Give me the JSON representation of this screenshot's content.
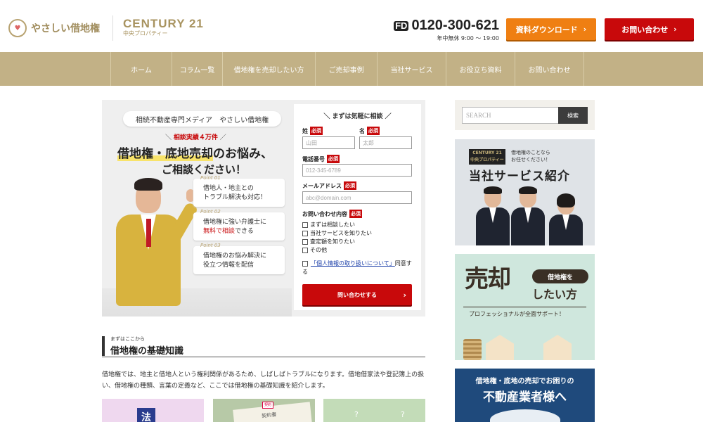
{
  "header": {
    "site_name": "やさしい借地権",
    "brand": "CENTURY 21",
    "brand_sub": "中央プロパティー",
    "phone_prefix": "FD",
    "phone": "0120-300-621",
    "hours": "年中無休 9:00 〜 19:00",
    "download_label": "資料ダウンロード",
    "contact_label": "お問い合わせ"
  },
  "nav": {
    "items": [
      {
        "label": "ホーム"
      },
      {
        "label": "コラム一覧"
      },
      {
        "label": "借地権を売却したい方"
      },
      {
        "label": "ご売却事例"
      },
      {
        "label": "当社サービス"
      },
      {
        "label": "お役立ち資料"
      },
      {
        "label": "お問い合わせ"
      }
    ]
  },
  "hero": {
    "media_tag": "相続不動産専門メディア　やさしい借地権",
    "record_prefix": "＼ ",
    "record": "相談実績４万件",
    "record_suffix": " ／",
    "headline_a": "借地権・底地売却",
    "headline_b": "のお悩み、",
    "headline_2": "ご相談ください！",
    "points": [
      {
        "label": "Point 01",
        "line1": "借地人・地主との",
        "line2": "トラブル解決も対応！"
      },
      {
        "label": "Point 02",
        "line1": "借地権に強い弁護士に",
        "line2a": "無料で相談",
        "line2b": "できる"
      },
      {
        "label": "Point 03",
        "line1": "借地権のお悩み解決に",
        "line2": "役立つ情報を配信"
      }
    ]
  },
  "form": {
    "title": "＼ まずは気軽に相談 ／",
    "required": "必須",
    "last_name_label": "姓",
    "last_name_placeholder": "山田",
    "first_name_label": "名",
    "first_name_placeholder": "太郎",
    "phone_label": "電話番号",
    "phone_placeholder": "012-345-6789",
    "email_label": "メールアドレス",
    "email_placeholder": "abc@domain.com",
    "inquiry_label": "お問い合わせ内容",
    "options": [
      "まずは相談したい",
      "当社サービスを知りたい",
      "査定額を知りたい",
      "その他"
    ],
    "privacy_link": "「個人情報の取り扱いについて」",
    "privacy_suffix": "同意する",
    "submit_label": "問い合わせする"
  },
  "section": {
    "subtitle": "まずはここから",
    "title": "借地権の基礎知識",
    "body": "借地権では、地主と借地人という権利関係があるため、しばしばトラブルになります。借地借家法や登記簿上の扱い、借地権の種類、言葉の定義など、ここでは借地権の基礎知識を紹介します。",
    "thumb1_text": "法",
    "thumb2_text": "契約書",
    "thumb2_stamp": "契約",
    "thumb3_q": "?"
  },
  "sidebar": {
    "search_placeholder": "SEARCH",
    "search_button": "検索",
    "banner1": {
      "logo": "CENTURY 21",
      "logo_sub": "中央プロパティー",
      "tag1": "借地権のことなら",
      "tag2": "お任せください！",
      "title": "当社サービス紹介"
    },
    "banner2": {
      "big": "売却",
      "pill": "借地権を",
      "want": "したい方",
      "pro": "プロフェッショナルが全面サポート！"
    },
    "banner3": {
      "line1": "借地権・底地の売却でお困りの",
      "line2": "不動産業者様へ"
    }
  },
  "colors": {
    "gold": "#c2b186",
    "orange": "#ef7f12",
    "red": "#c8090b",
    "navy": "#1f4a7c"
  }
}
